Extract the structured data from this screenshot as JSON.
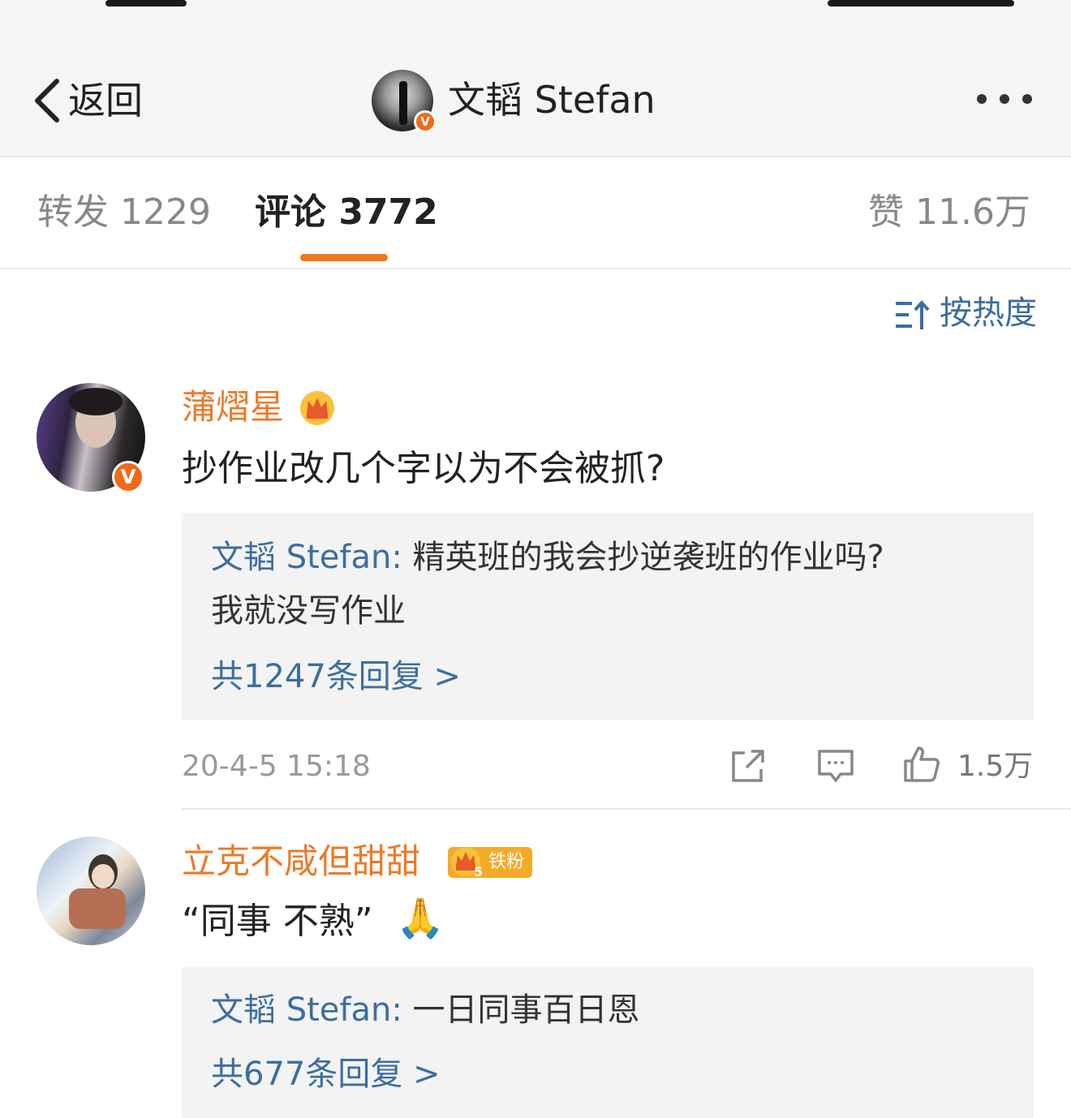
{
  "nav": {
    "back_label": "返回",
    "title": "文韬 Stefan",
    "verified_mark": "V"
  },
  "tabs": {
    "repost": "转发 1229",
    "comment": "评论 3772",
    "like": "赞 11.6万"
  },
  "sort": {
    "label": "按热度"
  },
  "comments": [
    {
      "username": "蒲熠星",
      "verified_mark": "V",
      "text": "抄作业改几个字以为不会被抓?",
      "reply": {
        "author": "文韬 Stefan:",
        "line1": " 精英班的我会抄逆袭班的作业吗?",
        "line2": "我就没写作业",
        "count_label": "共1247条回复 >"
      },
      "timestamp": "20-4-5 15:18",
      "likes": "1.5万"
    },
    {
      "username": "立克不咸但甜甜",
      "fan_badge": "铁粉",
      "fan_level": "5",
      "text": "“同事 不熟”",
      "emoji": "🙏",
      "reply": {
        "author": "文韬 Stefan:",
        "line1": " 一日同事百日恩",
        "count_label": "共677条回复 >"
      }
    }
  ],
  "colors": {
    "accent_orange": "#f2791b",
    "username_orange": "#eb7a28",
    "link_blue": "#3c6e9f",
    "reply_bg": "#f3f3f3"
  }
}
